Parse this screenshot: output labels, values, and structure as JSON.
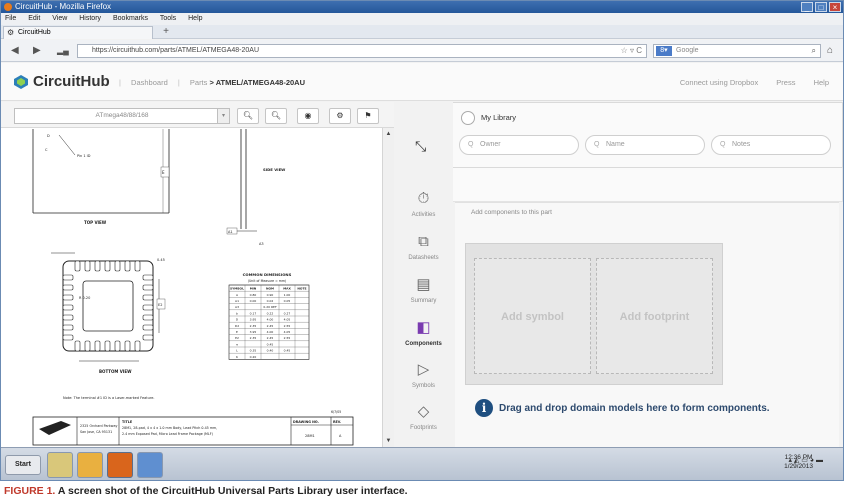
{
  "window": {
    "title": "CircuitHub - Mozilla Firefox",
    "controls": [
      "_",
      "□",
      "×"
    ]
  },
  "menu": [
    "File",
    "Edit",
    "View",
    "History",
    "Bookmarks",
    "Tools",
    "Help"
  ],
  "tab": {
    "label": "CircuitHub",
    "new_tab": "+"
  },
  "nav": {
    "url": "https://circuithub.com/parts/ATMEL/ATMEGA48-20AU",
    "search_placeholder": "Google"
  },
  "app": {
    "logo": "CircuitHub",
    "breadcrumb": {
      "dashboard": "Dashboard",
      "parts": "Parts",
      "current": "ATMEL/ATMEGA48-20AU"
    },
    "header_links": [
      "Connect using Dropbox",
      "Press",
      "Help"
    ]
  },
  "viewer": {
    "part_select": "ATmega48/88/168",
    "tools": [
      "zoom-in",
      "zoom-out",
      "fit",
      "settings",
      "flag"
    ]
  },
  "drawing": {
    "views": {
      "top": "TOP VIEW",
      "side": "SIDE VIEW",
      "bottom": "BOTTOM VIEW"
    },
    "table_title": "COMMON DIMENSIONS",
    "table_sub": "(Unit of Measure = mm)",
    "table_headers": [
      "SYMBOL",
      "MIN",
      "NOM",
      "MAX",
      "NOTE"
    ],
    "table_rows": [
      [
        "A",
        "0.80",
        "0.90",
        "1.00",
        ""
      ],
      [
        "A1",
        "0.00",
        "0.02",
        "0.05",
        ""
      ],
      [
        "A3",
        "",
        "0.20 REF",
        "",
        ""
      ],
      [
        "b",
        "0.17",
        "0.22",
        "0.27",
        ""
      ],
      [
        "D",
        "3.95",
        "4.00",
        "4.05",
        ""
      ],
      [
        "D2",
        "2.35",
        "2.45",
        "2.55",
        ""
      ],
      [
        "E",
        "3.95",
        "4.00",
        "4.05",
        ""
      ],
      [
        "E2",
        "2.35",
        "2.45",
        "2.55",
        ""
      ],
      [
        "e",
        "",
        "0.45",
        "",
        ""
      ],
      [
        "L",
        "0.35",
        "0.40",
        "0.45",
        ""
      ],
      [
        "K",
        "0.20",
        "",
        "",
        ""
      ]
    ],
    "note": "Note: The terminal #1 ID is a Laser-marked Feature.",
    "pin_label": "Pin 1 ID",
    "r_label": "R 0.20",
    "pitch_label": "0.45",
    "date": "6/7/05",
    "title_block": {
      "company_line1": "2325 Orchard Parkway",
      "company_line2": "San Jose, CA  95131",
      "title_label": "TITLE",
      "title_line1": "28M1, 28-pad, 4 x 4 x 1.0 mm Body, Lead Pitch 0.45 mm,",
      "title_line2": "2.4 mm Exposed Pad, Micro Lead Frame Package (MLF)",
      "drawing_no_label": "DRAWING NO.",
      "drawing_no": "28M1",
      "rev_label": "REV.",
      "rev": "A"
    }
  },
  "sidenav": {
    "items": [
      {
        "label": "Activities",
        "icon": "stopwatch-icon"
      },
      {
        "label": "Datasheets",
        "icon": "datasheet-icon"
      },
      {
        "label": "Summary",
        "icon": "summary-icon"
      },
      {
        "label": "Components",
        "icon": "components-icon"
      },
      {
        "label": "Symbols",
        "icon": "symbol-icon"
      },
      {
        "label": "Footprints",
        "icon": "footprint-icon"
      }
    ]
  },
  "library": {
    "title": "My Library",
    "search": {
      "owner": "Owner",
      "name": "Name",
      "notes": "Notes"
    }
  },
  "components": {
    "hint": "Add components to this part",
    "add_symbol": "Add symbol",
    "add_footprint": "Add footprint",
    "drag_message": "Drag and drop domain models here to form components."
  },
  "taskbar": {
    "start": "Start",
    "time": "12:36 PM",
    "date": "1/29/2013"
  },
  "caption": {
    "figure": "FIGURE 1.",
    "text": " A screen shot of the CircuitHub Universal Parts Library user interface."
  }
}
